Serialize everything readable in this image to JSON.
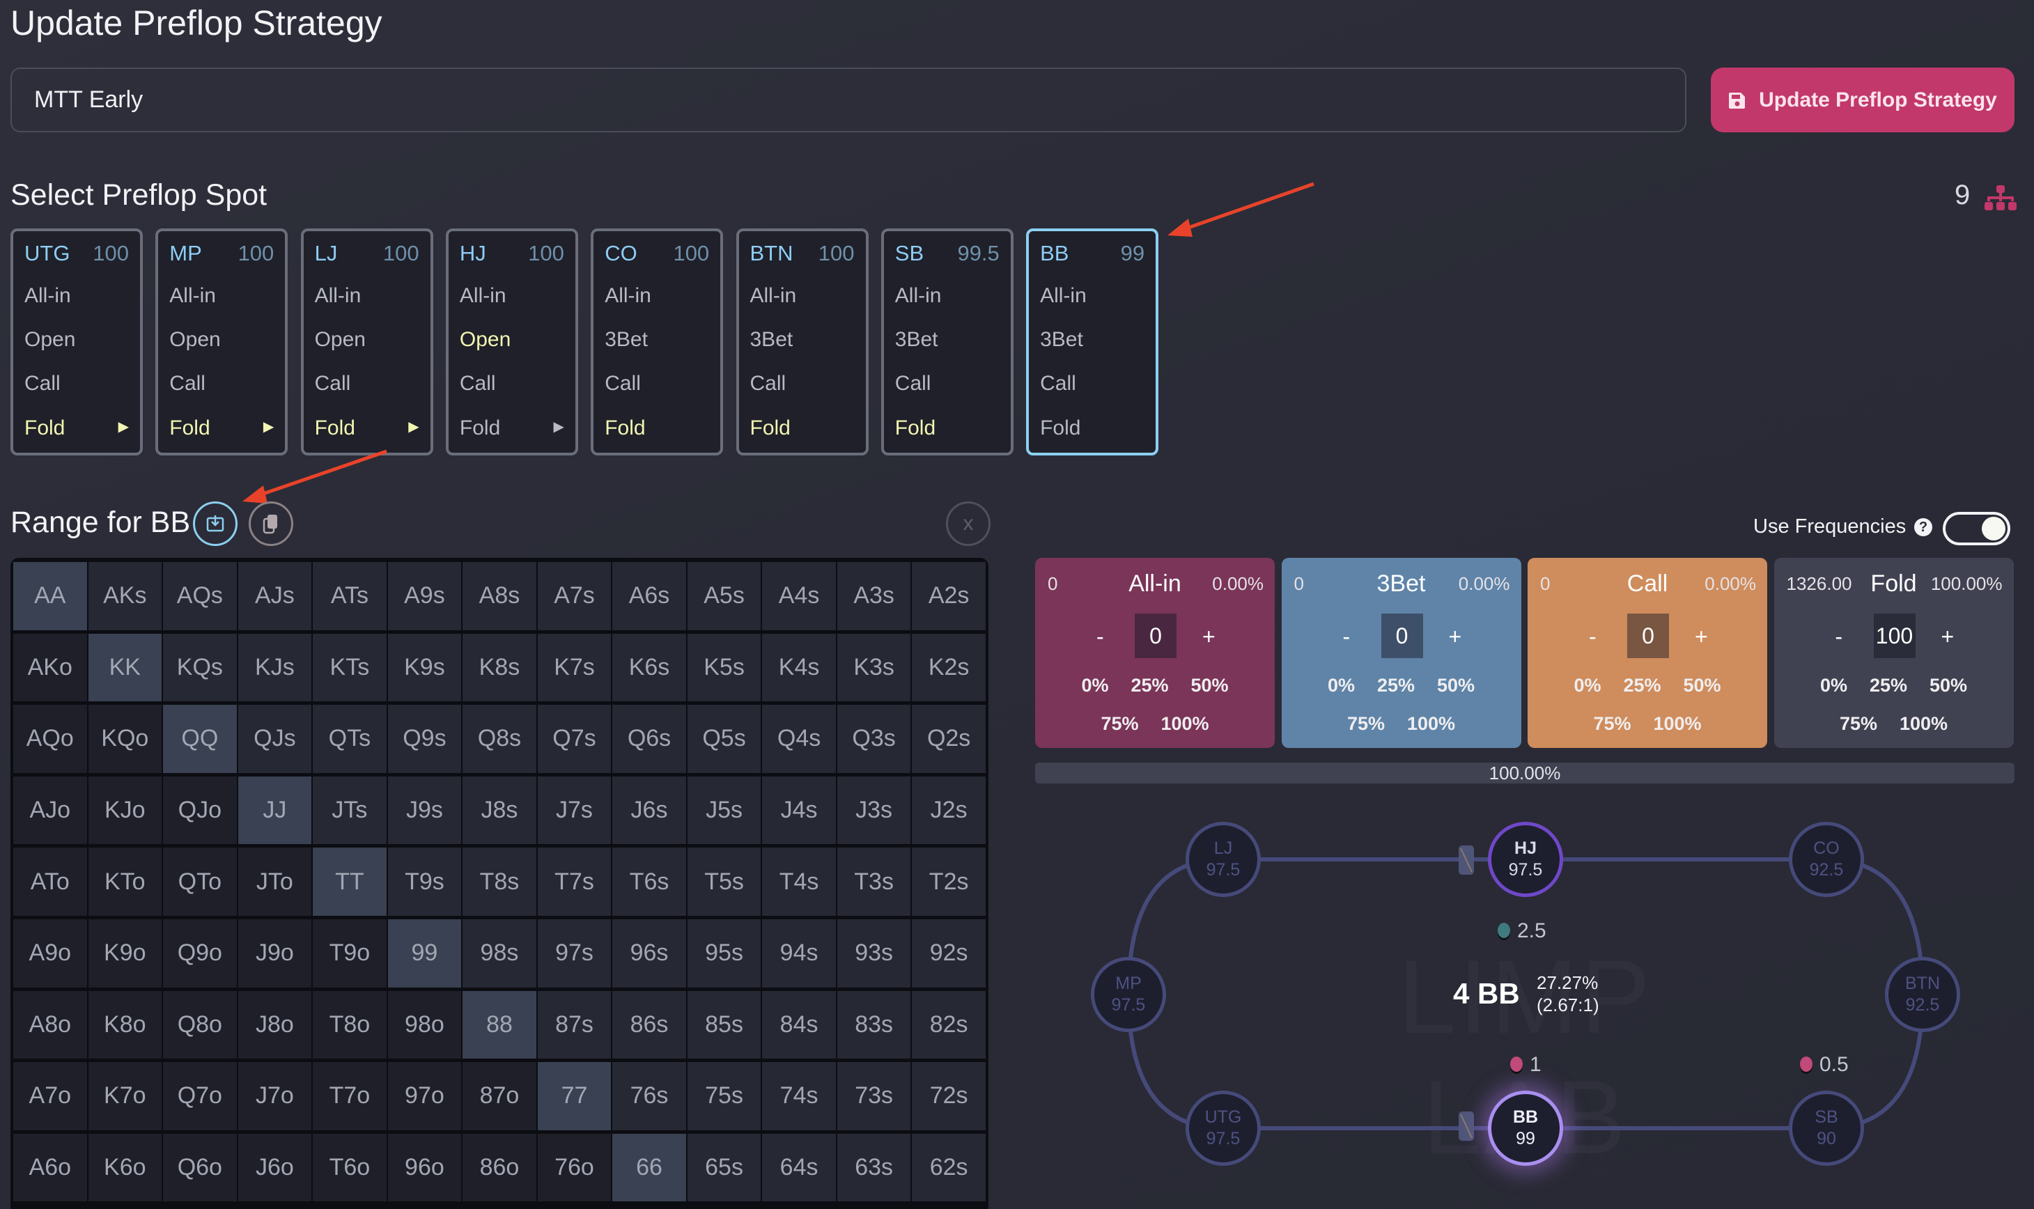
{
  "header": {
    "title": "Update Preflop Strategy",
    "strategy_name": "MTT Early",
    "update_button": "Update Preflop Strategy",
    "update_icon": "floppy-disk-icon",
    "accent": "#c2386a"
  },
  "spot_section": {
    "title": "Select Preflop Spot",
    "count": "9",
    "count_icon": "sitemap-icon",
    "spots": [
      {
        "pos": "UTG",
        "stack": "100",
        "actions": [
          {
            "label": "All-in",
            "selected": false
          },
          {
            "label": "Open",
            "selected": false
          },
          {
            "label": "Call",
            "selected": false
          },
          {
            "label": "Fold",
            "selected": true
          }
        ],
        "has_next": true,
        "next_selected": true,
        "active": false
      },
      {
        "pos": "MP",
        "stack": "100",
        "actions": [
          {
            "label": "All-in",
            "selected": false
          },
          {
            "label": "Open",
            "selected": false
          },
          {
            "label": "Call",
            "selected": false
          },
          {
            "label": "Fold",
            "selected": true
          }
        ],
        "has_next": true,
        "next_selected": true,
        "active": false
      },
      {
        "pos": "LJ",
        "stack": "100",
        "actions": [
          {
            "label": "All-in",
            "selected": false
          },
          {
            "label": "Open",
            "selected": false
          },
          {
            "label": "Call",
            "selected": false
          },
          {
            "label": "Fold",
            "selected": true
          }
        ],
        "has_next": true,
        "next_selected": true,
        "active": false
      },
      {
        "pos": "HJ",
        "stack": "100",
        "actions": [
          {
            "label": "All-in",
            "selected": false
          },
          {
            "label": "Open",
            "selected": true
          },
          {
            "label": "Call",
            "selected": false
          },
          {
            "label": "Fold",
            "selected": false
          }
        ],
        "has_next": true,
        "next_selected": false,
        "active": false
      },
      {
        "pos": "CO",
        "stack": "100",
        "actions": [
          {
            "label": "All-in",
            "selected": false
          },
          {
            "label": "3Bet",
            "selected": false
          },
          {
            "label": "Call",
            "selected": false
          },
          {
            "label": "Fold",
            "selected": true
          }
        ],
        "has_next": false,
        "active": false
      },
      {
        "pos": "BTN",
        "stack": "100",
        "actions": [
          {
            "label": "All-in",
            "selected": false
          },
          {
            "label": "3Bet",
            "selected": false
          },
          {
            "label": "Call",
            "selected": false
          },
          {
            "label": "Fold",
            "selected": true
          }
        ],
        "has_next": false,
        "active": false
      },
      {
        "pos": "SB",
        "stack": "99.5",
        "actions": [
          {
            "label": "All-in",
            "selected": false
          },
          {
            "label": "3Bet",
            "selected": false
          },
          {
            "label": "Call",
            "selected": false
          },
          {
            "label": "Fold",
            "selected": true
          }
        ],
        "has_next": false,
        "active": false
      },
      {
        "pos": "BB",
        "stack": "99",
        "actions": [
          {
            "label": "All-in",
            "selected": false
          },
          {
            "label": "3Bet",
            "selected": false
          },
          {
            "label": "Call",
            "selected": false
          },
          {
            "label": "Fold",
            "selected": false
          }
        ],
        "has_next": false,
        "active": true
      }
    ]
  },
  "range": {
    "title": "Range for BB",
    "export_icon": "export-icon",
    "copy_icon": "copy-icon",
    "close_label": "x",
    "rows": [
      [
        "AA",
        "AKs",
        "AQs",
        "AJs",
        "ATs",
        "A9s",
        "A8s",
        "A7s",
        "A6s",
        "A5s",
        "A4s",
        "A3s",
        "A2s"
      ],
      [
        "AKo",
        "KK",
        "KQs",
        "KJs",
        "KTs",
        "K9s",
        "K8s",
        "K7s",
        "K6s",
        "K5s",
        "K4s",
        "K3s",
        "K2s"
      ],
      [
        "AQo",
        "KQo",
        "QQ",
        "QJs",
        "QTs",
        "Q9s",
        "Q8s",
        "Q7s",
        "Q6s",
        "Q5s",
        "Q4s",
        "Q3s",
        "Q2s"
      ],
      [
        "AJo",
        "KJo",
        "QJo",
        "JJ",
        "JTs",
        "J9s",
        "J8s",
        "J7s",
        "J6s",
        "J5s",
        "J4s",
        "J3s",
        "J2s"
      ],
      [
        "ATo",
        "KTo",
        "QTo",
        "JTo",
        "TT",
        "T9s",
        "T8s",
        "T7s",
        "T6s",
        "T5s",
        "T4s",
        "T3s",
        "T2s"
      ],
      [
        "A9o",
        "K9o",
        "Q9o",
        "J9o",
        "T9o",
        "99",
        "98s",
        "97s",
        "96s",
        "95s",
        "94s",
        "93s",
        "92s"
      ],
      [
        "A8o",
        "K8o",
        "Q8o",
        "J8o",
        "T8o",
        "98o",
        "88",
        "87s",
        "86s",
        "85s",
        "84s",
        "83s",
        "82s"
      ],
      [
        "A7o",
        "K7o",
        "Q7o",
        "J7o",
        "T7o",
        "97o",
        "87o",
        "77",
        "76s",
        "75s",
        "74s",
        "73s",
        "72s"
      ],
      [
        "A6o",
        "K6o",
        "Q6o",
        "J6o",
        "T6o",
        "96o",
        "86o",
        "76o",
        "66",
        "65s",
        "64s",
        "63s",
        "62s"
      ]
    ]
  },
  "frequencies": {
    "label": "Use Frequencies",
    "help": "?",
    "enabled": true,
    "actions": [
      {
        "name": "All-in",
        "combos": "0",
        "pct": "0.00%",
        "value": "0",
        "color": "#7a3558",
        "input_color": "#4a2740"
      },
      {
        "name": "3Bet",
        "combos": "0",
        "pct": "0.00%",
        "value": "0",
        "color": "#5f84a8",
        "input_color": "#3e4f69"
      },
      {
        "name": "Call",
        "combos": "0",
        "pct": "0.00%",
        "value": "0",
        "color": "#cf8c5c",
        "input_color": "#785641"
      },
      {
        "name": "Fold",
        "combos": "1326.00",
        "pct": "100.00%",
        "value": "100",
        "color": "#404252",
        "input_color": "#2b2c39"
      }
    ],
    "minus": "-",
    "plus": "+",
    "presets": [
      "0%",
      "25%",
      "50%",
      "75%",
      "100%"
    ],
    "total": "100.00%"
  },
  "table": {
    "watermark": "LIMP LAB",
    "seats": [
      {
        "pos": "LJ",
        "stack": "97.5"
      },
      {
        "pos": "HJ",
        "stack": "97.5"
      },
      {
        "pos": "CO",
        "stack": "92.5"
      },
      {
        "pos": "MP",
        "stack": "97.5"
      },
      {
        "pos": "BTN",
        "stack": "92.5"
      },
      {
        "pos": "UTG",
        "stack": "97.5"
      },
      {
        "pos": "BB",
        "stack": "99"
      },
      {
        "pos": "SB",
        "stack": "90"
      }
    ],
    "bets": [
      {
        "seat": "HJ",
        "amount": "2.5",
        "color": "#3f7a80"
      },
      {
        "seat": "BB",
        "amount": "1",
        "color": "#c04a7a"
      },
      {
        "seat": "SB",
        "amount": "0.5",
        "color": "#c04a7a"
      }
    ],
    "pot": "4 BB",
    "pot_odds_pct": "27.27%",
    "pot_odds_ratio": "(2.67:1)"
  }
}
